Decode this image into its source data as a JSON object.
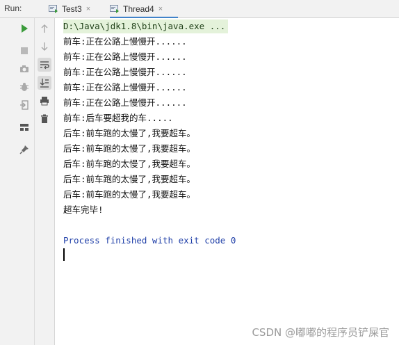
{
  "run_panel": {
    "label": "Run:",
    "tabs": [
      {
        "label": "Test3",
        "close": "×",
        "active": false
      },
      {
        "label": "Thread4",
        "close": "×",
        "active": true
      }
    ]
  },
  "toolbar": {
    "outer_icons": [
      "play-icon",
      "stop-icon",
      "camera-icon",
      "bug-icon",
      "login-icon",
      "layout-icon",
      "pin-icon"
    ],
    "inner_icons": [
      "arrow-up-icon",
      "arrow-down-icon",
      "soft-wrap-icon",
      "scroll-to-end-icon",
      "print-icon",
      "trash-icon"
    ]
  },
  "console": {
    "command": "D:\\Java\\jdk1.8\\bin\\java.exe ...",
    "lines": [
      "前车:正在公路上慢慢开......",
      "前车:正在公路上慢慢开......",
      "前车:正在公路上慢慢开......",
      "前车:正在公路上慢慢开......",
      "前车:正在公路上慢慢开......",
      "前车:后车要超我的车.....",
      "后车:前车跑的太慢了,我要超车。",
      "后车:前车跑的太慢了,我要超车。",
      "后车:前车跑的太慢了,我要超车。",
      "后车:前车跑的太慢了,我要超车。",
      "后车:前车跑的太慢了,我要超车。",
      "超车完毕!"
    ],
    "exit_message": "Process finished with exit code 0"
  },
  "watermark": "CSDN @嘟嘟的程序员铲屎官",
  "colors": {
    "accent": "#4083c9",
    "play": "#3b9b3b",
    "process_text": "#1f3fa8",
    "command_bg": "#e4f2da"
  }
}
